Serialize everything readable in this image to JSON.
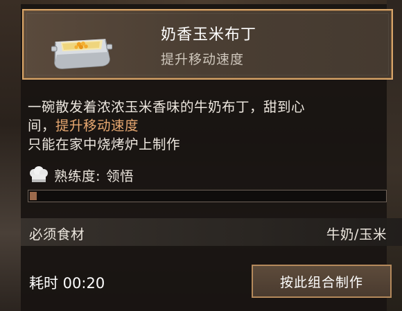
{
  "recipe": {
    "name": "奶香玉米布丁",
    "effect": "提升移动速度",
    "icon": "pudding-dish-icon",
    "description_line1_prefix": "一碗散发着浓浓玉米香味的牛奶布丁，甜到心",
    "description_line2_prefix": "间，",
    "description_highlight": "提升移动速度",
    "description_line3": "只能在家中烧烤炉上制作"
  },
  "mastery": {
    "icon": "chef-hat-icon",
    "label": "熟练度:",
    "value": "领悟",
    "progress_fraction": 0.02
  },
  "ingredients": {
    "label": "必须食材",
    "value": "牛奶/玉米"
  },
  "cook": {
    "time_text": "耗时 00:20",
    "button_label": "按此组合制作"
  },
  "colors": {
    "card_border": "#d9a66a",
    "highlight_text": "#e7a871",
    "progress_fill": "#9b6a4c"
  }
}
